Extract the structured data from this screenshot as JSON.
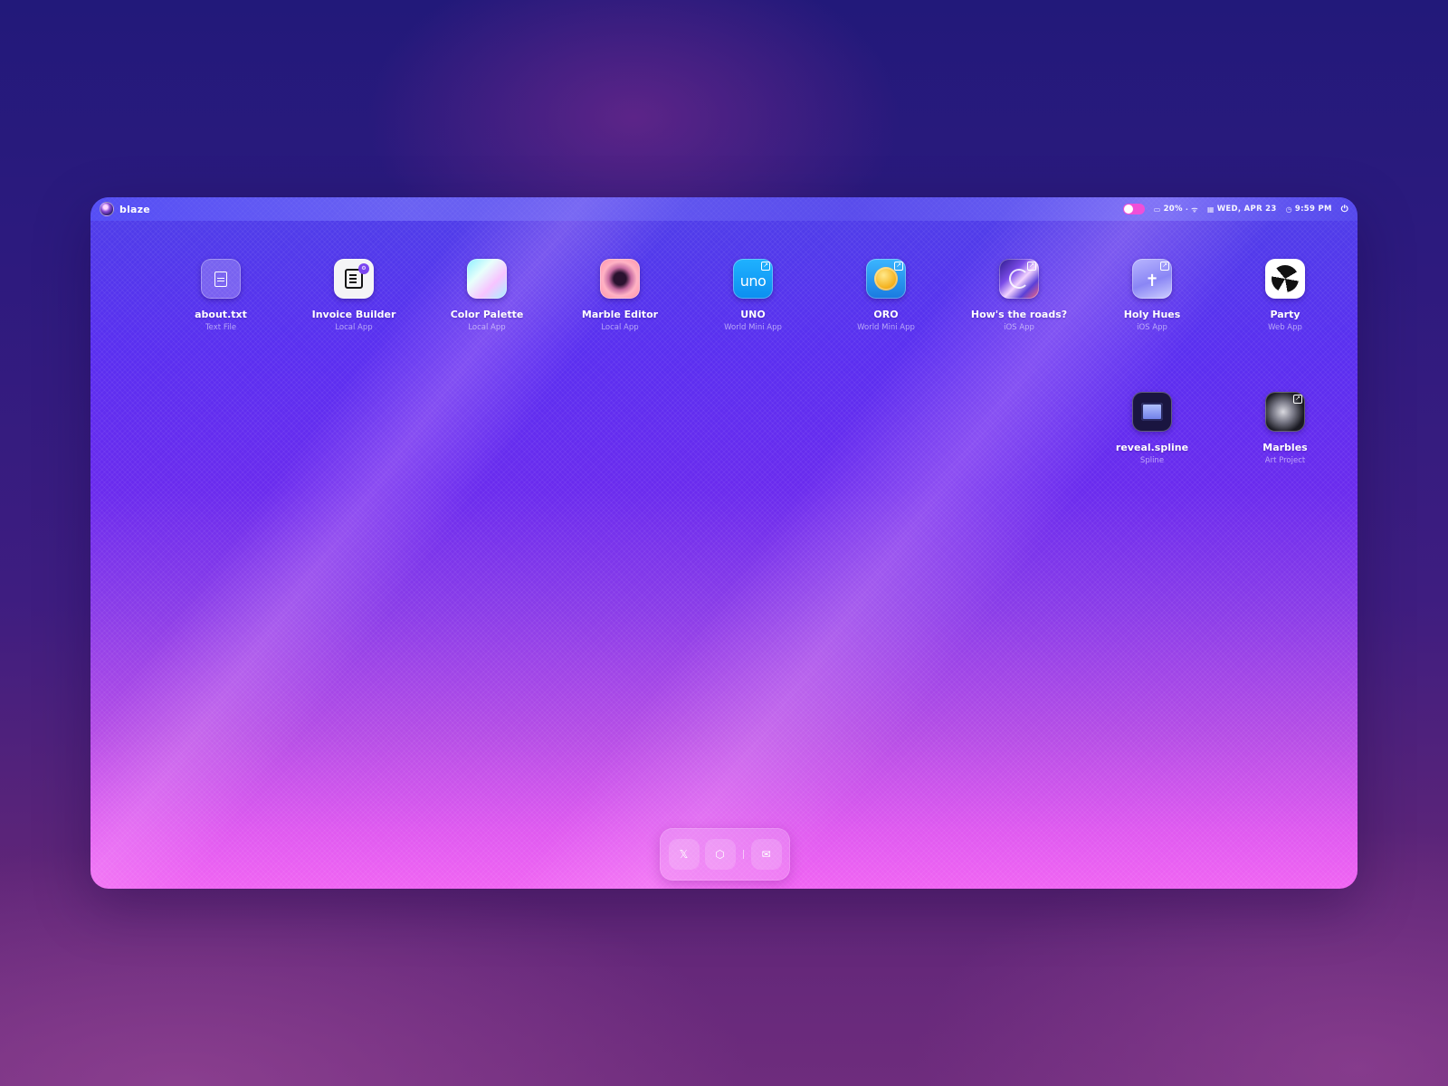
{
  "menubar": {
    "brand": "blaze",
    "battery": "20%",
    "date": "WED, APR 23",
    "time": "9:59 PM"
  },
  "apps": [
    {
      "name": "about.txt",
      "type": "Text File",
      "icon": "text-file-icon"
    },
    {
      "name": "Invoice Builder",
      "type": "Local App",
      "icon": "invoice-icon"
    },
    {
      "name": "Color Palette",
      "type": "Local App",
      "icon": "palette-icon"
    },
    {
      "name": "Marble Editor",
      "type": "Local App",
      "icon": "marble-icon"
    },
    {
      "name": "UNO",
      "type": "World Mini App",
      "icon": "uno-icon",
      "glyph": "uno"
    },
    {
      "name": "ORO",
      "type": "World Mini App",
      "icon": "oro-coin-icon"
    },
    {
      "name": "How's the roads?",
      "type": "iOS App",
      "icon": "roads-icon"
    },
    {
      "name": "Holy Hues",
      "type": "iOS App",
      "icon": "cross-icon",
      "glyph": "✝"
    },
    {
      "name": "Party",
      "type": "Web App",
      "icon": "party-icon"
    },
    {
      "name": "reveal.spline",
      "type": "Spline",
      "icon": "spline-file-icon"
    },
    {
      "name": "Marbles",
      "type": "Art Project",
      "icon": "marbles-icon"
    }
  ],
  "dock": {
    "x_label": "𝕏",
    "codepen_label": "⬡",
    "mail_label": "✉"
  },
  "colors": {
    "toggle_on": "#f04fd8",
    "accent": "#7b46f0"
  }
}
